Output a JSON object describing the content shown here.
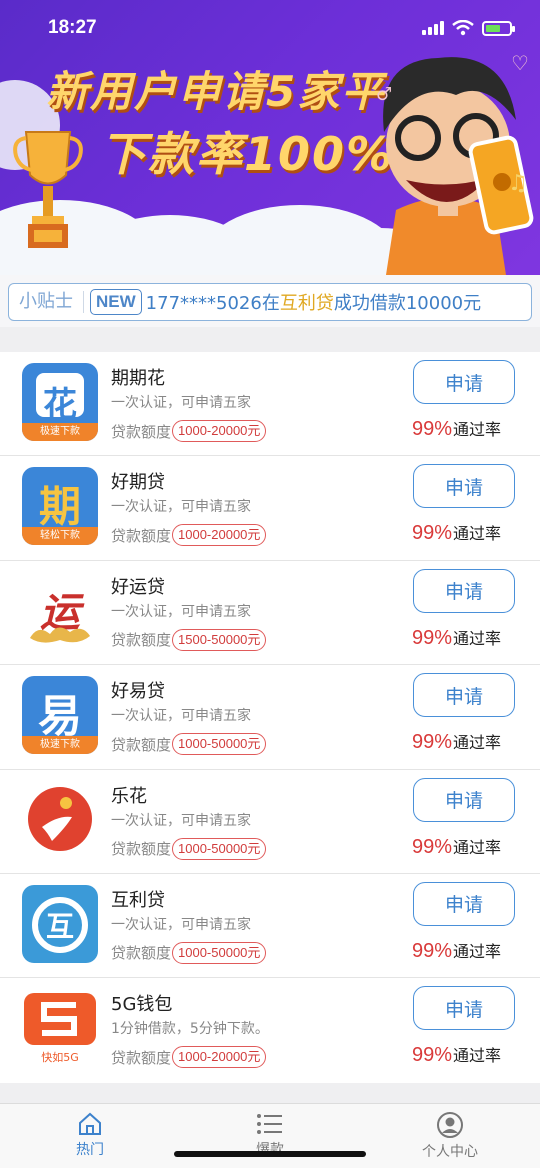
{
  "status": {
    "time": "18:27"
  },
  "banner": {
    "line1": "新用户申请5家平台",
    "line2": "下款率100%!"
  },
  "tip": {
    "label": "小贴士",
    "badge": "NEW",
    "prefix": "177****5026在",
    "highlight": "互利贷",
    "suffix": "成功借款10000元"
  },
  "items": [
    {
      "name": "期期花",
      "desc": "一次认证，可申请五家",
      "amount_label": "贷款额度",
      "amount": "1000-20000元",
      "apply": "申请",
      "rate": "99%",
      "rate_label": "通过率",
      "logo_text": "花",
      "logo_band": "极速下款",
      "logo_color": "#3b86d8"
    },
    {
      "name": "好期贷",
      "desc": "一次认证，可申请五家",
      "amount_label": "贷款额度",
      "amount": "1000-20000元",
      "apply": "申请",
      "rate": "99%",
      "rate_label": "通过率",
      "logo_text": "期",
      "logo_band": "轻松下款",
      "logo_color": "#3b86d8"
    },
    {
      "name": "好运贷",
      "desc": "一次认证，可申请五家",
      "amount_label": "贷款额度",
      "amount": "1500-50000元",
      "apply": "申请",
      "rate": "99%",
      "rate_label": "通过率",
      "logo_text": "运",
      "logo_band": "",
      "logo_color": "#ffffff"
    },
    {
      "name": "好易贷",
      "desc": "一次认证，可申请五家",
      "amount_label": "贷款额度",
      "amount": "1000-50000元",
      "apply": "申请",
      "rate": "99%",
      "rate_label": "通过率",
      "logo_text": "易",
      "logo_band": "极速下款",
      "logo_color": "#3b86d8"
    },
    {
      "name": "乐花",
      "desc": "一次认证，可申请五家",
      "amount_label": "贷款额度",
      "amount": "1000-50000元",
      "apply": "申请",
      "rate": "99%",
      "rate_label": "通过率",
      "logo_text": "",
      "logo_band": "",
      "logo_color": "#ffffff"
    },
    {
      "name": "互利贷",
      "desc": "一次认证，可申请五家",
      "amount_label": "贷款额度",
      "amount": "1000-50000元",
      "apply": "申请",
      "rate": "99%",
      "rate_label": "通过率",
      "logo_text": "互",
      "logo_band": "",
      "logo_color": "#3b86d8"
    },
    {
      "name": "5G钱包",
      "desc": "1分钟借款，5分钟下款。",
      "amount_label": "贷款额度",
      "amount": "1000-20000元",
      "apply": "申请",
      "rate": "99%",
      "rate_label": "通过率",
      "logo_text": "",
      "logo_band": "快如5G",
      "logo_color": "#ffffff"
    }
  ],
  "tabs": [
    {
      "label": "热门",
      "icon": "home-icon",
      "active": true
    },
    {
      "label": "爆款",
      "icon": "list-icon",
      "active": false
    },
    {
      "label": "个人中心",
      "icon": "user-icon",
      "active": false
    }
  ],
  "colors": {
    "accent": "#3d82cc",
    "rate": "#d93a3a",
    "banner": "#6d2fd8"
  }
}
